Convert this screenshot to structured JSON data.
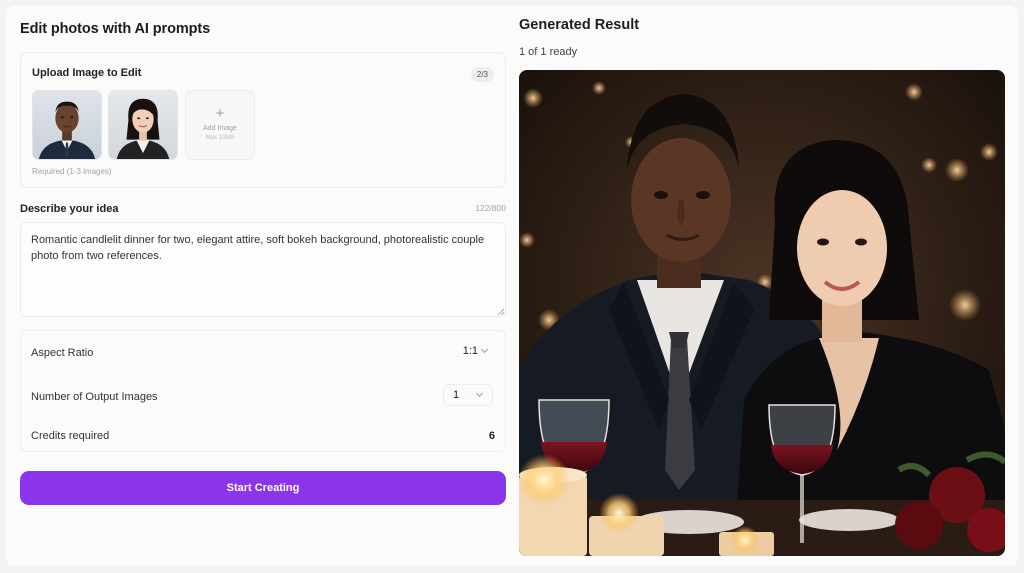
{
  "editor": {
    "title": "Edit photos with AI prompts",
    "upload": {
      "title": "Upload Image to Edit",
      "count": "2/3",
      "add_label": "Add Image",
      "max_size": "Max 10MB",
      "hint": "Required (1-3 images)"
    },
    "idea": {
      "label": "Describe your idea",
      "char_count": "122/800",
      "prompt": "Romantic candlelit dinner for two, elegant attire, soft bokeh background, photorealistic couple photo from two references."
    },
    "settings": {
      "aspect_label": "Aspect Ratio",
      "aspect_value": "1:1",
      "outputs_label": "Number of Output Images",
      "outputs_value": "1",
      "credits_label": "Credits required",
      "credits_value": "6"
    },
    "start_label": "Start Creating"
  },
  "result": {
    "title": "Generated Result",
    "status": "1 of 1 ready"
  },
  "colors": {
    "accent": "#8a35ea",
    "card_bg": "#fbfbfa",
    "page_bg": "#f3f3f3"
  },
  "icons": {
    "add": "plus-icon",
    "dropdown": "chevron-down-icon"
  }
}
